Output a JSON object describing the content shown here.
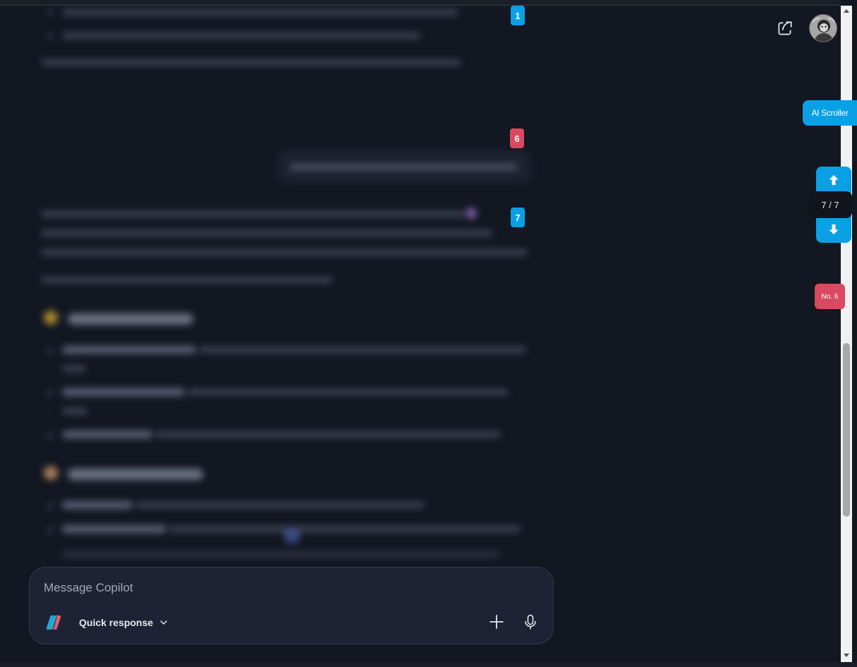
{
  "composer": {
    "placeholder": "Message Copilot",
    "mode_label": "Quick response"
  },
  "markers": {
    "m1": "1",
    "m6": "6",
    "m7": "7"
  },
  "ai_scroller": {
    "label": "AI Scroller",
    "counter": "7 / 7",
    "jump_label": "No. 6"
  },
  "colors": {
    "accent_blue": "#0aa0e6",
    "accent_red": "#d94a60",
    "background": "#131722"
  },
  "icons": [
    "share-icon",
    "avatar",
    "copilot-logo-icon",
    "chevron-down-icon",
    "plus-icon",
    "microphone-icon",
    "arrow-up-icon",
    "arrow-down-icon"
  ]
}
